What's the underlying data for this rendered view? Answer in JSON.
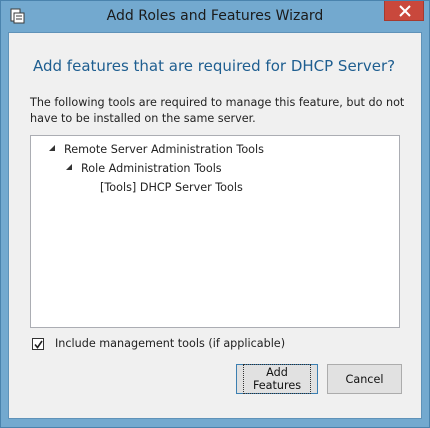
{
  "window": {
    "title": "Add Roles and Features Wizard",
    "icons": {
      "app": "wizard-app-icon",
      "close": "close-icon"
    }
  },
  "dialog": {
    "heading": "Add features that are required for DHCP Server?",
    "description": "The following tools are required to manage this feature, but do not have to be installed on the same server.",
    "tree": [
      {
        "label": "Remote Server Administration Tools",
        "level": 0,
        "expanded": true
      },
      {
        "label": "Role Administration Tools",
        "level": 1,
        "expanded": true
      },
      {
        "label": "[Tools] DHCP Server Tools",
        "level": 2,
        "expanded": null
      }
    ],
    "include_tools": {
      "label": "Include management tools (if applicable)",
      "checked": true
    },
    "buttons": {
      "add": "Add Features",
      "cancel": "Cancel"
    }
  },
  "colors": {
    "frame": "#73a9cf",
    "heading": "#1e5e90",
    "close": "#c9483c"
  }
}
